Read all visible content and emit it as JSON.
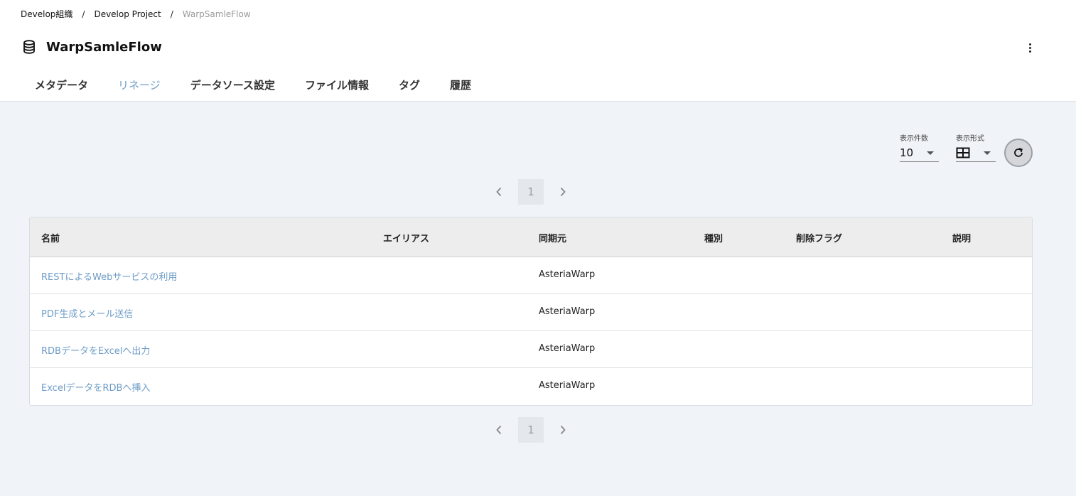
{
  "breadcrumb": {
    "items": [
      "Develop組織",
      "Develop Project",
      "WarpSamleFlow"
    ],
    "separator": "/"
  },
  "header": {
    "title": "WarpSamleFlow",
    "icon": "database-icon",
    "more_icon": "more-vert-icon"
  },
  "tabs": [
    {
      "label": "メタデータ",
      "active": false
    },
    {
      "label": "リネージ",
      "active": true
    },
    {
      "label": "データソース設定",
      "active": false
    },
    {
      "label": "ファイル情報",
      "active": false
    },
    {
      "label": "タグ",
      "active": false
    },
    {
      "label": "履歴",
      "active": false
    }
  ],
  "controls": {
    "count_label": "表示件数",
    "count_value": "10",
    "format_label": "表示形式",
    "format_icon": "table-grid-icon",
    "refresh_icon": "refresh-icon"
  },
  "pagination": {
    "current_page": "1"
  },
  "table": {
    "columns": [
      "名前",
      "エイリアス",
      "同期元",
      "種別",
      "削除フラグ",
      "説明"
    ],
    "rows": [
      {
        "name": "RESTによるWebサービスの利用",
        "alias": "",
        "source": "AsteriaWarp",
        "kind": "",
        "delete_flag": "",
        "description": ""
      },
      {
        "name": "PDF生成とメール送信",
        "alias": "",
        "source": "AsteriaWarp",
        "kind": "",
        "delete_flag": "",
        "description": ""
      },
      {
        "name": "RDBデータをExcelへ出力",
        "alias": "",
        "source": "AsteriaWarp",
        "kind": "",
        "delete_flag": "",
        "description": ""
      },
      {
        "name": "ExcelデータをRDBへ挿入",
        "alias": "",
        "source": "AsteriaWarp",
        "kind": "",
        "delete_flag": "",
        "description": ""
      }
    ]
  },
  "colors": {
    "accent": "#6d9cc7",
    "background": "#f0f3f7",
    "header_bg": "#ffffff"
  }
}
